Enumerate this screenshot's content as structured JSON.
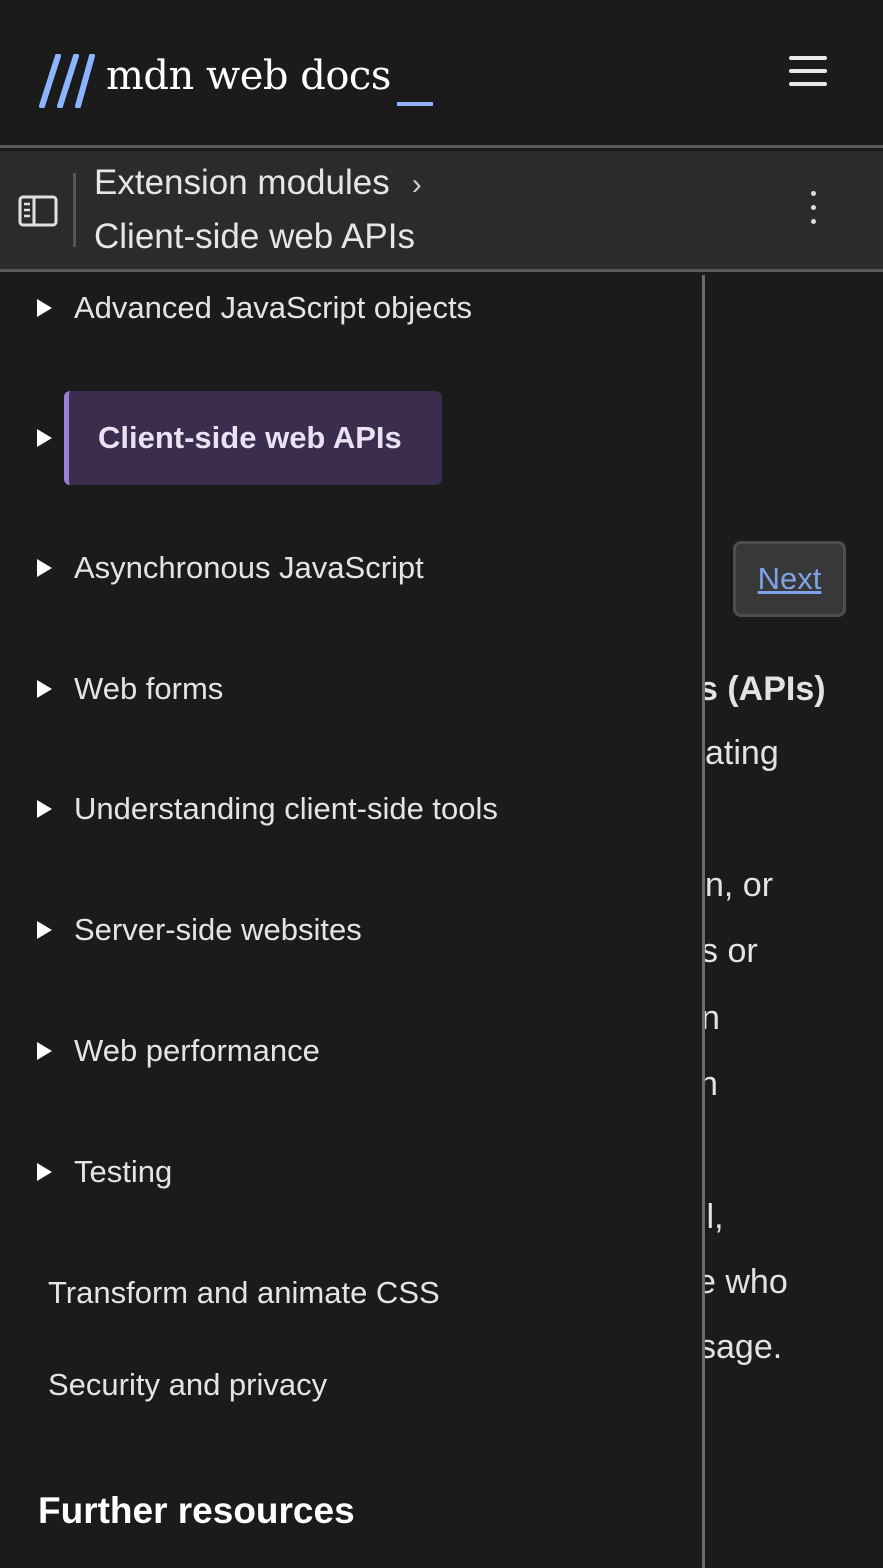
{
  "header": {
    "logo_text": "mdn web docs",
    "logo_accent_color": "#8cb4ff",
    "menu_icon": "hamburger-icon"
  },
  "breadcrumb": {
    "toggle_icon": "sidebar-toggle-icon",
    "items": [
      "Extension modules",
      "Client-side web APIs"
    ],
    "more_icon": "kebab-icon"
  },
  "sidebar": {
    "items": [
      {
        "label": "Advanced JavaScript objects",
        "expandable": true
      },
      {
        "label": "Client-side web APIs",
        "expandable": true,
        "active": true
      },
      {
        "label": "Asynchronous JavaScript",
        "expandable": true
      },
      {
        "label": "Web forms",
        "expandable": true
      },
      {
        "label": "Understanding client-side tools",
        "expandable": true
      },
      {
        "label": "Server-side websites",
        "expandable": true
      },
      {
        "label": "Web performance",
        "expandable": true
      },
      {
        "label": "Testing",
        "expandable": true
      },
      {
        "label": "Transform and animate CSS",
        "expandable": false
      },
      {
        "label": "Security and privacy",
        "expandable": false
      }
    ],
    "section_title": "Further resources",
    "active_color": "#3a2d4d"
  },
  "main": {
    "next_label": "Next",
    "fragments": [
      "s (APIs)",
      "ating",
      "n, or",
      "s or",
      "n",
      "n",
      "il,",
      "e who",
      "sage."
    ]
  }
}
